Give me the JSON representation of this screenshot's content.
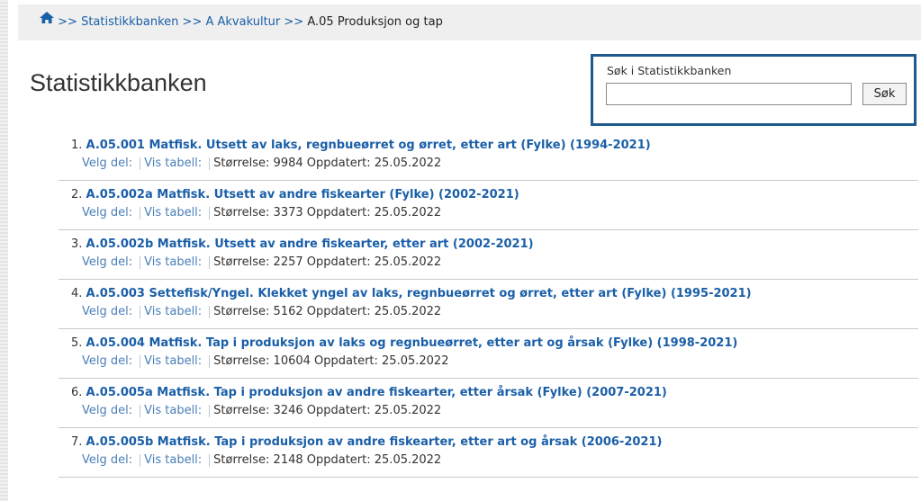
{
  "breadcrumb": {
    "separator": ">>",
    "items": [
      "Statistikkbanken",
      "A Akvakultur"
    ],
    "current": "A.05 Produksjon og tap"
  },
  "page_title": "Statistikkbanken",
  "search": {
    "label": "Søk i Statistikkbanken",
    "value": "",
    "button_label": "Søk"
  },
  "result_labels": {
    "velg_del": "Velg del:",
    "vis_tabell": "Vis tabell:"
  },
  "results": [
    {
      "num": "1.",
      "title": "A.05.001 Matfisk. Utsett av laks, regnbueørret og ørret, etter art (Fylke) (1994-2021)",
      "info": "Størrelse: 9984 Oppdatert: 25.05.2022"
    },
    {
      "num": "2.",
      "title": "A.05.002a Matfisk. Utsett av andre fiskearter (Fylke) (2002-2021)",
      "info": "Størrelse: 3373 Oppdatert: 25.05.2022"
    },
    {
      "num": "3.",
      "title": "A.05.002b Matfisk. Utsett av andre fiskearter, etter art (2002-2021)",
      "info": "Størrelse: 2257 Oppdatert: 25.05.2022"
    },
    {
      "num": "4.",
      "title": "A.05.003 Settefisk/Yngel. Klekket yngel av laks, regnbueørret og ørret, etter art (Fylke) (1995-2021)",
      "info": "Størrelse: 5162 Oppdatert: 25.05.2022"
    },
    {
      "num": "5.",
      "title": "A.05.004 Matfisk. Tap i produksjon av laks og regnbueørret, etter art og årsak (Fylke) (1998-2021)",
      "info": "Størrelse: 10604 Oppdatert: 25.05.2022"
    },
    {
      "num": "6.",
      "title": "A.05.005a Matfisk. Tap i produksjon av andre fiskearter, etter årsak (Fylke) (2007-2021)",
      "info": "Størrelse: 3246 Oppdatert: 25.05.2022"
    },
    {
      "num": "7.",
      "title": "A.05.005b Matfisk. Tap i produksjon av andre fiskearter, etter art og årsak (2006-2021)",
      "info": "Størrelse: 2148 Oppdatert: 25.05.2022"
    }
  ],
  "colors": {
    "link": "#1a5fa8",
    "search_border": "#1f5a8f",
    "breadcrumb_bg": "#efefef"
  },
  "icons": {
    "home": "home-icon"
  }
}
